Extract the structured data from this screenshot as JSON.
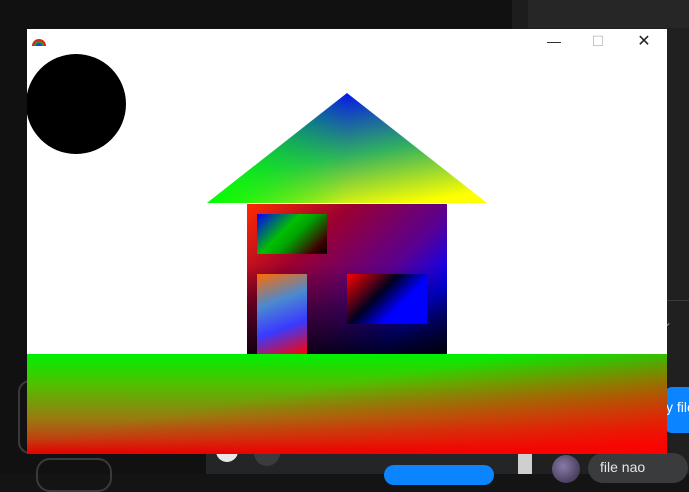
{
  "background_app": {
    "action_label": "y file",
    "chat_message": "file nao"
  },
  "window": {
    "title": "",
    "controls": {
      "minimize": "—",
      "maximize": "☐",
      "close": "✕"
    }
  },
  "drawing": {
    "shapes": [
      "sun",
      "roof",
      "house-body",
      "window",
      "door",
      "window",
      "ground"
    ],
    "colors": {
      "sun": "#000000",
      "roof_top": "#0000ff",
      "roof_left": "#00ff00",
      "roof_right": "#ffff00",
      "ground_top": "#00ff00",
      "ground_bottom": "#ff0000",
      "house_body_right": "#0000ff",
      "house_body_left": "#ff0000"
    }
  }
}
